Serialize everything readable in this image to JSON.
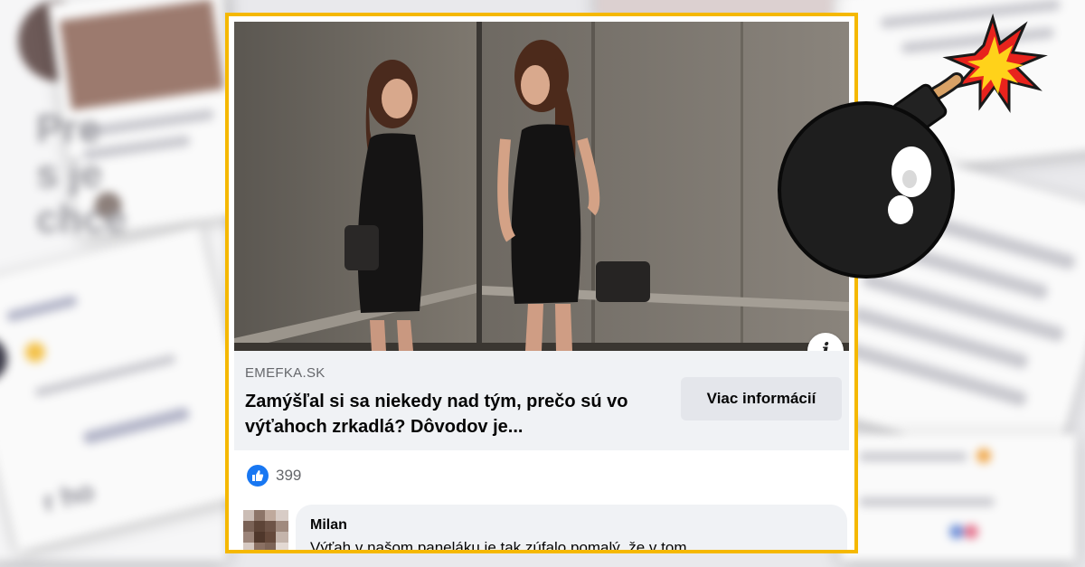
{
  "post": {
    "domain": "EMEFKA.SK",
    "headline": "Zamýšľal si sa niekedy nad tým, prečo sú vo výťahoch zrkadlá? Dôvodov je...",
    "more_button": "Viac informácií",
    "info_symbol": "i",
    "like_count": "399"
  },
  "comment": {
    "author": "Milan",
    "text": "Výťah v našom paneláku je tak zúfalo pomalý, že v tom"
  },
  "colors": {
    "frame": "#f5b800",
    "facebook_blue": "#1877f2",
    "link_area": "#f0f2f5"
  },
  "icons": [
    "info-icon",
    "like-icon",
    "bomb-icon"
  ]
}
